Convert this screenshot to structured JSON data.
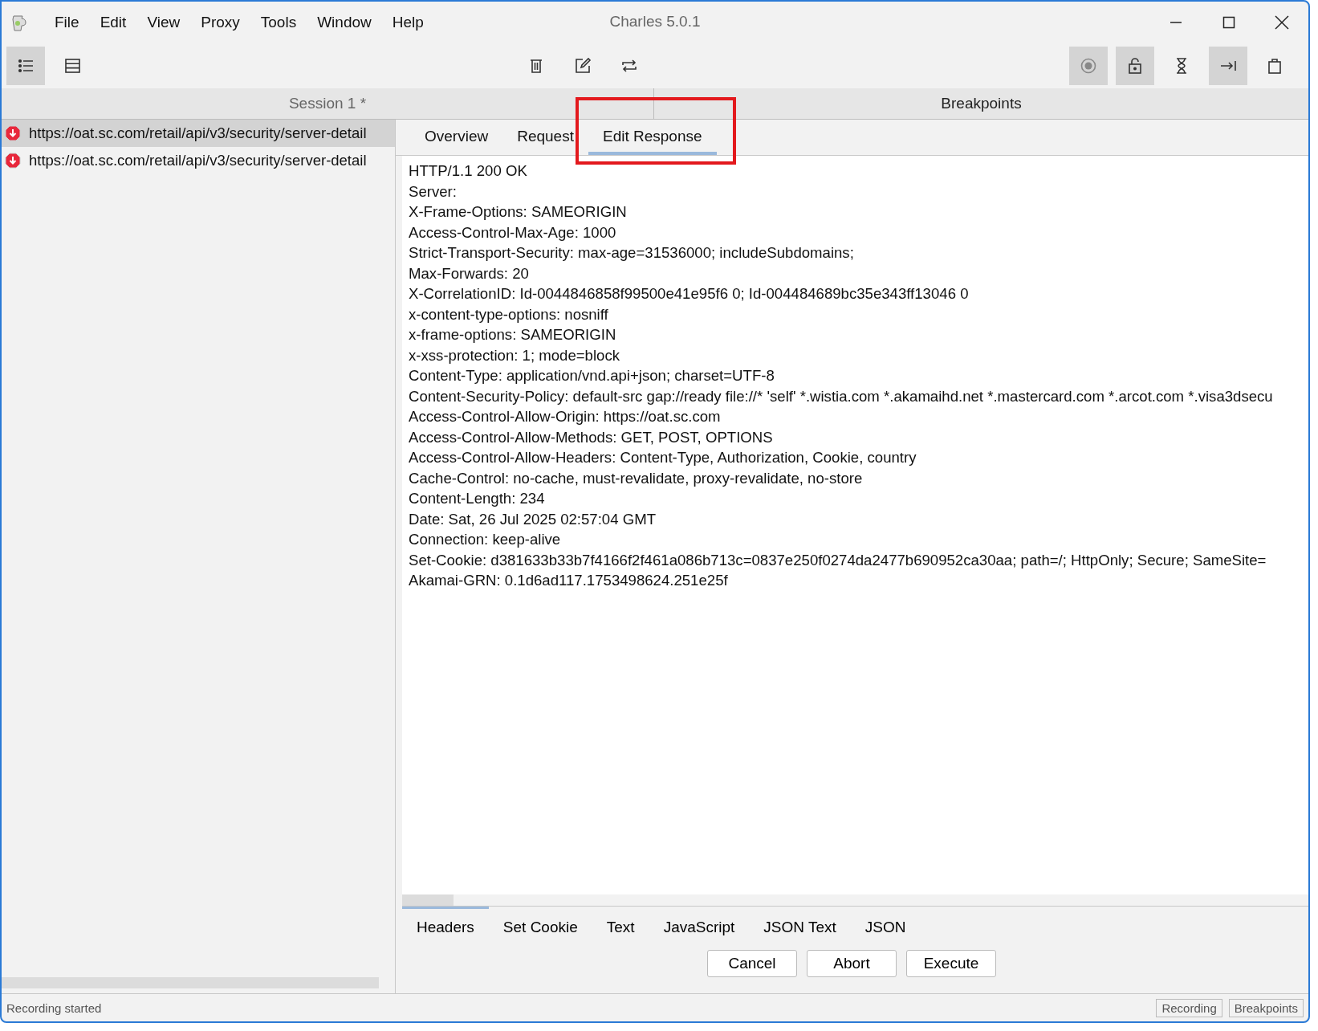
{
  "window": {
    "title": "Charles 5.0.1"
  },
  "menu": [
    "File",
    "Edit",
    "View",
    "Proxy",
    "Tools",
    "Window",
    "Help"
  ],
  "toolbar": {
    "left": [
      {
        "kind": "list",
        "active": true
      },
      {
        "kind": "rows",
        "active": false
      }
    ],
    "center": [
      {
        "kind": "trash",
        "active": false
      },
      {
        "kind": "edit",
        "active": false
      },
      {
        "kind": "repeat",
        "active": false
      }
    ],
    "right": [
      {
        "kind": "record",
        "active": true
      },
      {
        "kind": "lock",
        "active": true
      },
      {
        "kind": "hourglass",
        "active": false
      },
      {
        "kind": "step",
        "active": true
      },
      {
        "kind": "bag",
        "active": false
      }
    ]
  },
  "session": {
    "title": "Session 1 *"
  },
  "requests": [
    {
      "url": "https://oat.sc.com/retail/api/v3/security/server-detail",
      "selected": true
    },
    {
      "url": "https://oat.sc.com/retail/api/v3/security/server-detail",
      "selected": false
    }
  ],
  "breakpoints": {
    "title": "Breakpoints",
    "tabs": [
      {
        "label": "Overview",
        "selected": false
      },
      {
        "label": "Request",
        "selected": false
      },
      {
        "label": "Edit Response",
        "selected": true
      }
    ],
    "lines": [
      "HTTP/1.1 200 OK",
      "Server:",
      "X-Frame-Options: SAMEORIGIN",
      "Access-Control-Max-Age: 1000",
      "Strict-Transport-Security: max-age=31536000; includeSubdomains;",
      "Max-Forwards: 20",
      "X-CorrelationID: Id-0044846858f99500e41e95f6 0; Id-004484689bc35e343ff13046 0",
      "x-content-type-options: nosniff",
      "x-frame-options: SAMEORIGIN",
      "x-xss-protection: 1; mode=block",
      "Content-Type: application/vnd.api+json; charset=UTF-8",
      "Content-Security-Policy: default-src gap://ready file://* 'self' *.wistia.com *.akamaihd.net *.mastercard.com *.arcot.com *.visa3dsecu",
      "Access-Control-Allow-Origin: https://oat.sc.com",
      "Access-Control-Allow-Methods: GET, POST, OPTIONS",
      "Access-Control-Allow-Headers: Content-Type, Authorization, Cookie, country",
      "Cache-Control: no-cache, must-revalidate, proxy-revalidate, no-store",
      "Content-Length: 234",
      "Date: Sat, 26 Jul 2025 02:57:04 GMT",
      "Connection: keep-alive",
      "Set-Cookie: d381633b33b7f4166f2f461a086b713c=0837e250f0274da2477b690952ca30aa; path=/; HttpOnly; Secure; SameSite=",
      "Akamai-GRN: 0.1d6ad117.1753498624.251e25f"
    ],
    "view_tabs": [
      {
        "label": "Headers",
        "selected": true
      },
      {
        "label": "Set Cookie",
        "selected": false
      },
      {
        "label": "Text",
        "selected": false
      },
      {
        "label": "JavaScript",
        "selected": false
      },
      {
        "label": "JSON Text",
        "selected": false
      },
      {
        "label": "JSON",
        "selected": false
      }
    ],
    "buttons": [
      "Cancel",
      "Abort",
      "Execute"
    ]
  },
  "status_bar": {
    "text": "Recording started",
    "indicators": [
      "Recording",
      "Breakpoints"
    ]
  }
}
